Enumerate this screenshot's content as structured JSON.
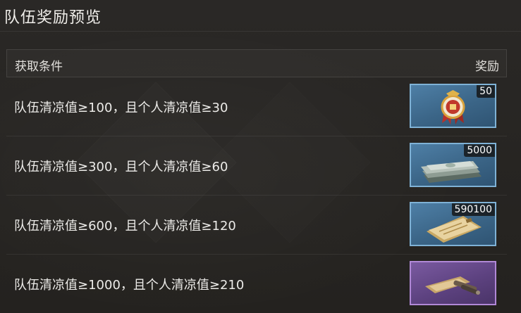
{
  "title": "队伍奖励预览",
  "table": {
    "header_condition": "获取条件",
    "header_reward": "奖励",
    "rows": [
      {
        "condition": "队伍清凉值≥100，且个人清凉值≥30",
        "reward_icon": "medal-icon",
        "quantity": "50",
        "frame": "blue"
      },
      {
        "condition": "队伍清凉值≥300，且个人清凉值≥60",
        "reward_icon": "cash-stack-icon",
        "quantity": "5000",
        "frame": "blue"
      },
      {
        "condition": "队伍清凉值≥600，且个人清凉值≥120",
        "reward_icon": "ticket-icon",
        "quantity": "590100",
        "frame": "blue"
      },
      {
        "condition": "队伍清凉值≥1000，且个人清凉值≥210",
        "reward_icon": "scroll-icon",
        "quantity": "",
        "frame": "purple"
      }
    ]
  },
  "colors": {
    "frame_blue": "#7fb2d6",
    "frame_purple": "#b088d6",
    "background": "#262422"
  }
}
